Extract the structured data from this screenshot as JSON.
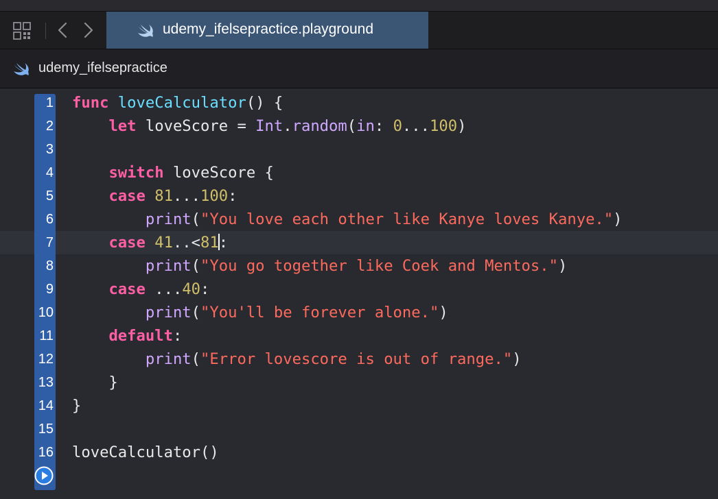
{
  "tab": {
    "title": "udemy_ifelsepractice.playground",
    "icon": "swift-icon"
  },
  "toolbar": {
    "grid_icon": "related-items-grid-icon",
    "back_icon": "chevron-left-icon",
    "forward_icon": "chevron-right-icon"
  },
  "jumpbar": {
    "label": "udemy_ifelsepractice",
    "icon": "swift-icon"
  },
  "editor": {
    "current_line": 7,
    "lines": [
      {
        "n": "1",
        "tokens": [
          [
            "kw",
            "func"
          ],
          [
            "plain",
            " "
          ],
          [
            "fn",
            "loveCalculator"
          ],
          [
            "plain",
            "() {"
          ]
        ]
      },
      {
        "n": "2",
        "tokens": [
          [
            "plain",
            "    "
          ],
          [
            "kw",
            "let"
          ],
          [
            "plain",
            " loveScore = "
          ],
          [
            "ty",
            "Int"
          ],
          [
            "plain",
            "."
          ],
          [
            "ty",
            "random"
          ],
          [
            "plain",
            "("
          ],
          [
            "ty",
            "in"
          ],
          [
            "plain",
            ": "
          ],
          [
            "num",
            "0"
          ],
          [
            "plain",
            "..."
          ],
          [
            "num",
            "100"
          ],
          [
            "plain",
            ")"
          ]
        ]
      },
      {
        "n": "3",
        "tokens": []
      },
      {
        "n": "4",
        "tokens": [
          [
            "plain",
            "    "
          ],
          [
            "kw",
            "switch"
          ],
          [
            "plain",
            " loveScore {"
          ]
        ]
      },
      {
        "n": "5",
        "tokens": [
          [
            "plain",
            "    "
          ],
          [
            "kw",
            "case"
          ],
          [
            "plain",
            " "
          ],
          [
            "num",
            "81"
          ],
          [
            "plain",
            "..."
          ],
          [
            "num",
            "100"
          ],
          [
            "plain",
            ":"
          ]
        ]
      },
      {
        "n": "6",
        "tokens": [
          [
            "plain",
            "        "
          ],
          [
            "ty",
            "print"
          ],
          [
            "plain",
            "("
          ],
          [
            "str",
            "\"You love each other like Kanye loves Kanye.\""
          ],
          [
            "plain",
            ")"
          ]
        ]
      },
      {
        "n": "7",
        "tokens": [
          [
            "plain",
            "    "
          ],
          [
            "kw",
            "case"
          ],
          [
            "plain",
            " "
          ],
          [
            "num",
            "41"
          ],
          [
            "plain",
            "..<"
          ],
          [
            "num",
            "81"
          ],
          [
            "cursor",
            ""
          ],
          [
            "plain",
            ":"
          ]
        ]
      },
      {
        "n": "8",
        "tokens": [
          [
            "plain",
            "        "
          ],
          [
            "ty",
            "print"
          ],
          [
            "plain",
            "("
          ],
          [
            "str",
            "\"You go together like Coek and Mentos.\""
          ],
          [
            "plain",
            ")"
          ]
        ]
      },
      {
        "n": "9",
        "tokens": [
          [
            "plain",
            "    "
          ],
          [
            "kw",
            "case"
          ],
          [
            "plain",
            " ..."
          ],
          [
            "num",
            "40"
          ],
          [
            "plain",
            ":"
          ]
        ]
      },
      {
        "n": "10",
        "tokens": [
          [
            "plain",
            "        "
          ],
          [
            "ty",
            "print"
          ],
          [
            "plain",
            "("
          ],
          [
            "str",
            "\"You'll be forever alone.\""
          ],
          [
            "plain",
            ")"
          ]
        ]
      },
      {
        "n": "11",
        "tokens": [
          [
            "plain",
            "    "
          ],
          [
            "kw",
            "default"
          ],
          [
            "plain",
            ":"
          ]
        ]
      },
      {
        "n": "12",
        "tokens": [
          [
            "plain",
            "        "
          ],
          [
            "ty",
            "print"
          ],
          [
            "plain",
            "("
          ],
          [
            "str",
            "\"Error lovescore is out of range.\""
          ],
          [
            "plain",
            ")"
          ]
        ]
      },
      {
        "n": "13",
        "tokens": [
          [
            "plain",
            "    }"
          ]
        ]
      },
      {
        "n": "14",
        "tokens": [
          [
            "plain",
            "}"
          ]
        ]
      },
      {
        "n": "15",
        "tokens": []
      },
      {
        "n": "16",
        "tokens": [
          [
            "plain",
            "loveCalculator()"
          ]
        ]
      }
    ],
    "run_icon": "play-icon"
  },
  "colors": {
    "keyword": "#fc5fa3",
    "function_decl": "#6bdfff",
    "type_member": "#d0a8ff",
    "number": "#d0bf69",
    "string": "#fc6a5d",
    "plain": "#e8e8e8",
    "gutter_breakpoint": "#2f5ea7",
    "active_tab": "#3b5575",
    "editor_bg": "#292a30"
  }
}
